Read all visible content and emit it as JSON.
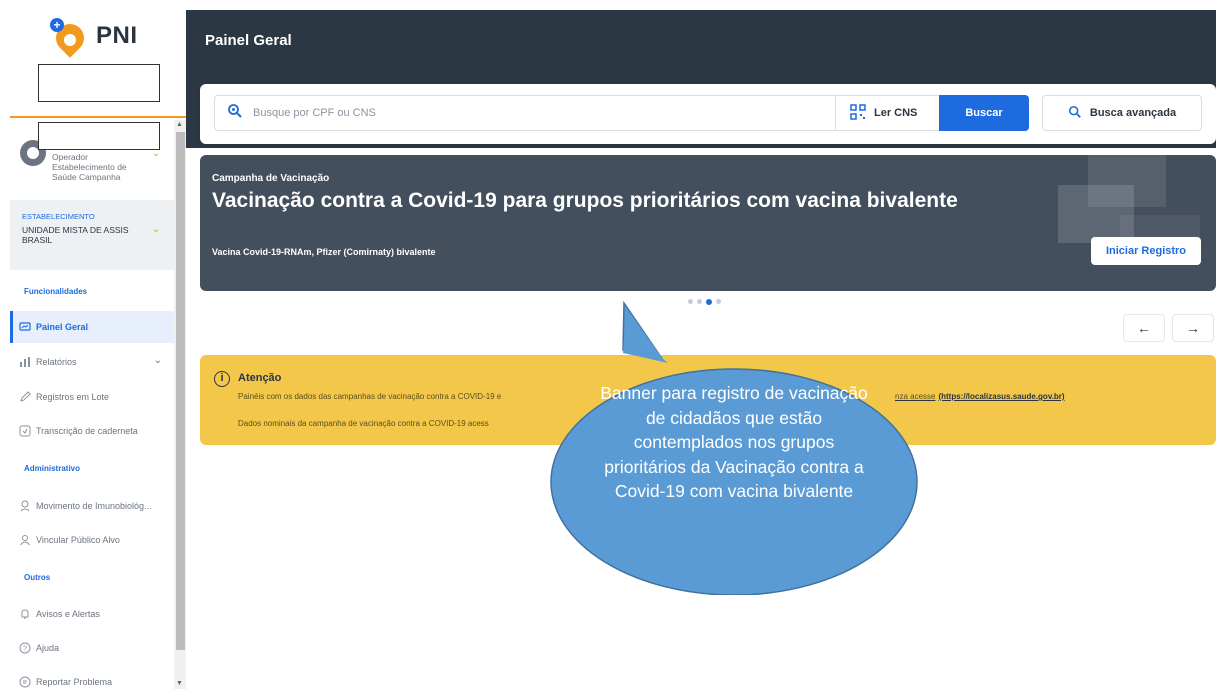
{
  "app": {
    "name": "PNI"
  },
  "user": {
    "lines": [
      "Operador",
      "Estabelecimento de",
      "Saúde Campanha"
    ]
  },
  "establishment": {
    "label": "ESTABELECIMENTO",
    "value": "UNIDADE MISTA DE ASSIS BRASIL"
  },
  "sidebar": {
    "sections": {
      "funcionalidades": "Funcionalidades",
      "administrativo": "Administrativo",
      "outros": "Outros"
    },
    "items": [
      {
        "label": "Painel Geral",
        "icon": "dashboard-icon",
        "active": true
      },
      {
        "label": "Relatórios",
        "icon": "chart-icon"
      },
      {
        "label": "Registros em Lote",
        "icon": "pencil-icon"
      },
      {
        "label": "Transcrição de caderneta",
        "icon": "document-icon"
      },
      {
        "label": "Movimento de Imunobiológ...",
        "icon": "vaccine-icon"
      },
      {
        "label": "Vincular Público Alvo",
        "icon": "user-icon"
      },
      {
        "label": "Avisos e Alertas",
        "icon": "bell-icon"
      },
      {
        "label": "Ajuda",
        "icon": "help-icon"
      },
      {
        "label": "Reportar Problema",
        "icon": "chat-icon"
      }
    ]
  },
  "header": {
    "title": "Painel Geral"
  },
  "search": {
    "placeholder": "Busque por CPF ou CNS",
    "ler_cns": "Ler CNS",
    "buscar": "Buscar",
    "busca_avancada": "Busca avançada"
  },
  "banner": {
    "subtitle": "Campanha de Vacinação",
    "title": "Vacinação contra a Covid-19 para grupos prioritários com vacina bivalente",
    "description": "Vacina Covid-19-RNAm, Pfizer (Comirnaty) bivalente",
    "button": "Iniciar Registro"
  },
  "carousel": {
    "total": 4,
    "active": 3
  },
  "alert": {
    "title": "Atenção",
    "line1": "Painéis com os dados das campanhas de vacinação contra a COVID-19 e",
    "line1_end": "nza acesse",
    "link": "(https://localizasus.saude.gov.br)",
    "line2": "Dados nominais da campanha de vacinação contra a COVID-19 acess"
  },
  "callout": {
    "text": "Banner para registro de vacinação de cidadãos que estão contemplados nos grupos prioritários da Vacinação contra a Covid-19 com vacina bivalente",
    "color": "#5b9bd5"
  },
  "colors": {
    "header": "#2c3744",
    "primary": "#1e6be0",
    "accent": "#f29a1f",
    "alert": "#f3c74a"
  }
}
